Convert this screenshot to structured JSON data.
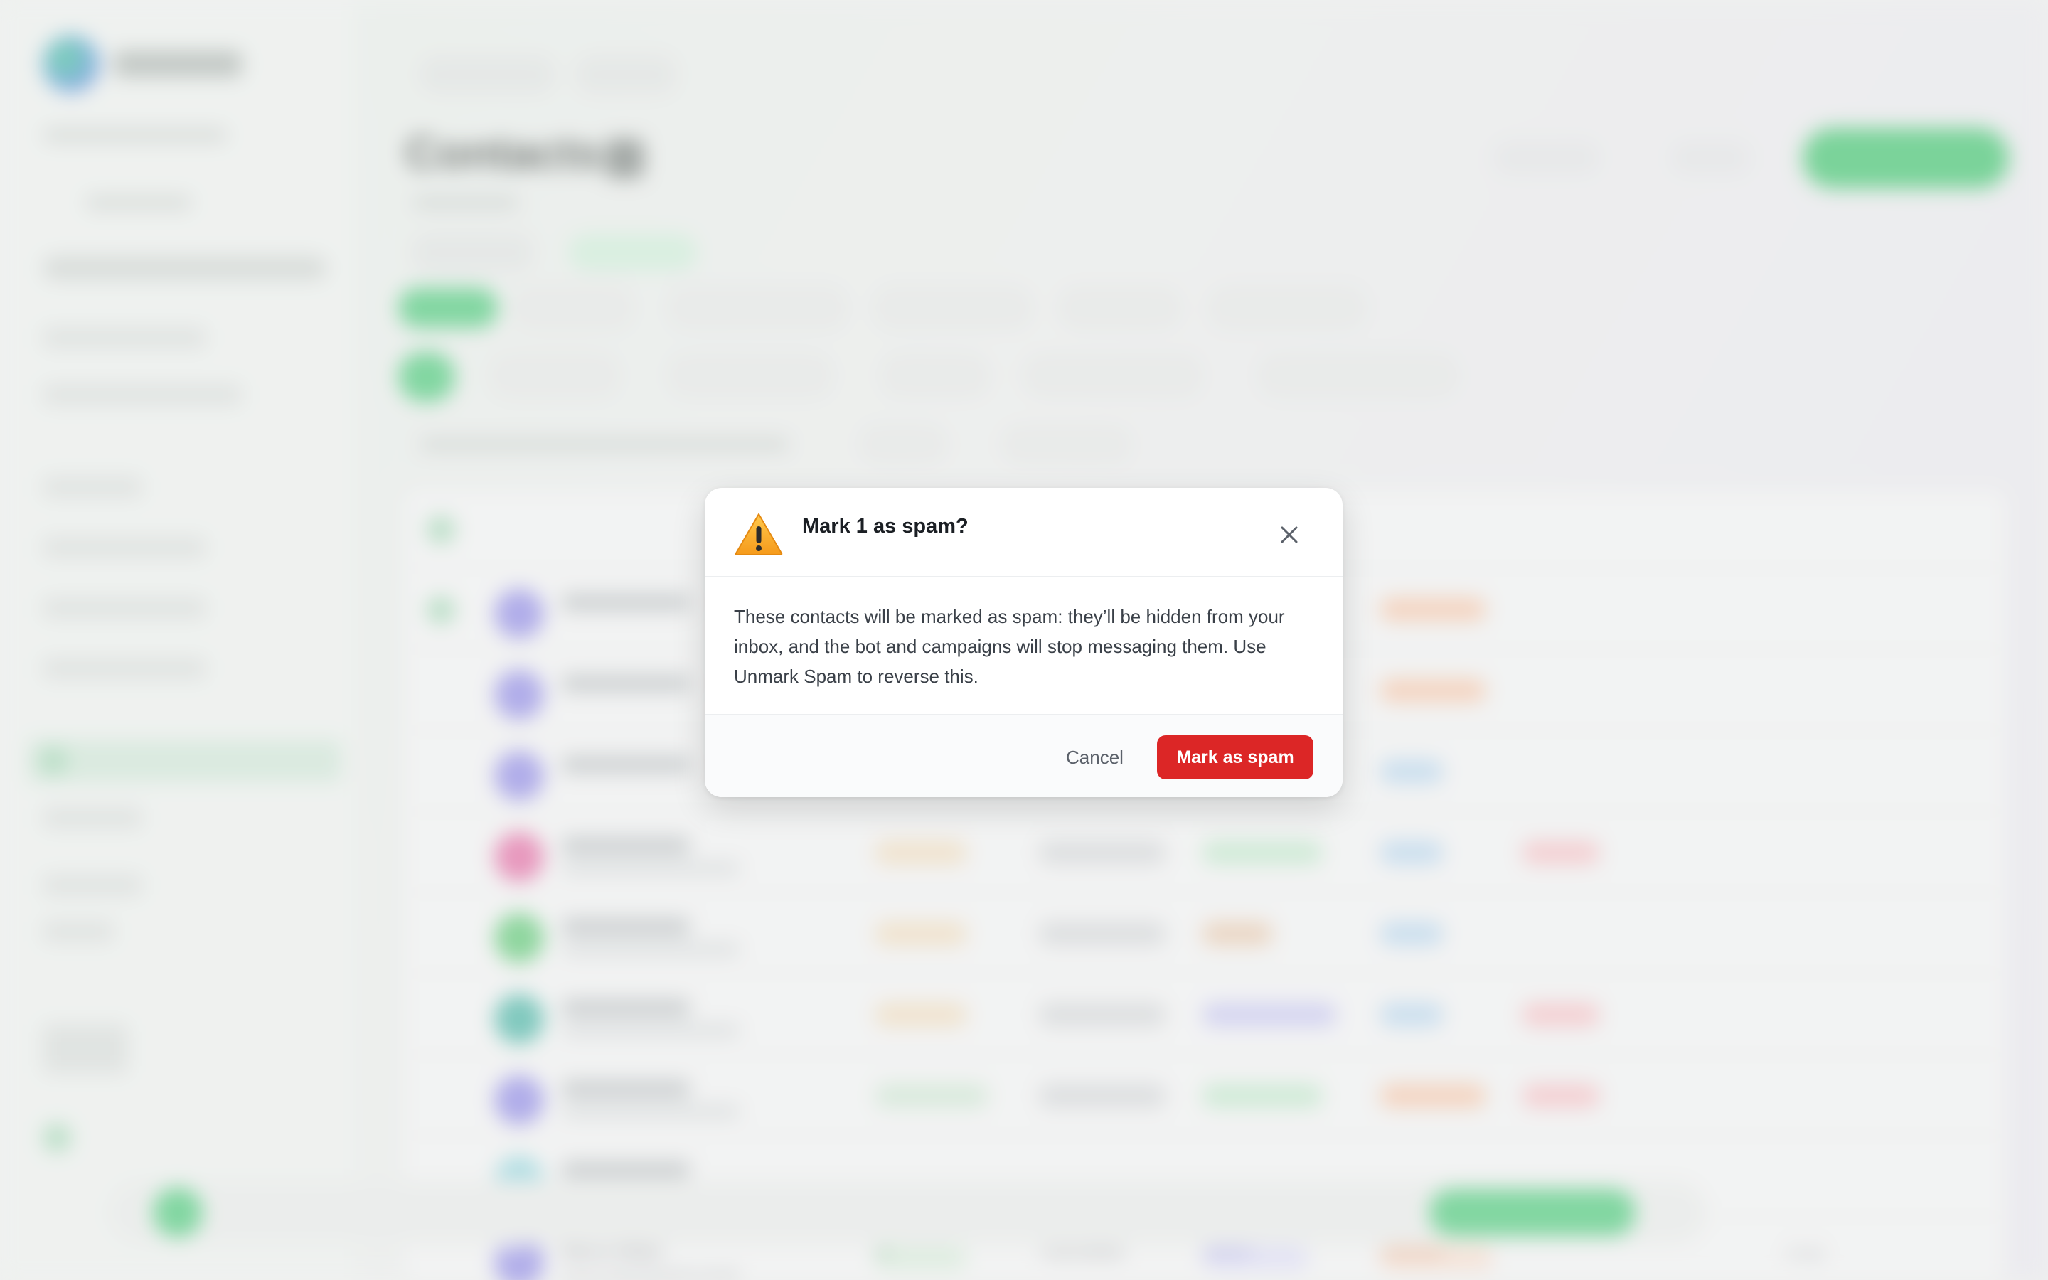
{
  "modal": {
    "title": "Mark 1 as spam?",
    "body": "These contacts will be marked as spam: they’ll be hidden from your inbox, and the bot and campaigns will stop messaging them. Use Unmark Spam to reverse this.",
    "cancel_label": "Cancel",
    "confirm_label": "Mark as spam",
    "icon": "warning-icon",
    "close_icon": "close-icon",
    "confirm_color": "#dc2626"
  },
  "background": {
    "page_title": "Contacts",
    "visible_row": {
      "initials": "MW",
      "name": "Marcus Weber",
      "email": "marcus.weber@weberconsulting.de",
      "score": "80",
      "phone": "+31612345054",
      "source": "WIDGET",
      "status": "ENGAGED",
      "last_seen": "2d ago"
    }
  }
}
